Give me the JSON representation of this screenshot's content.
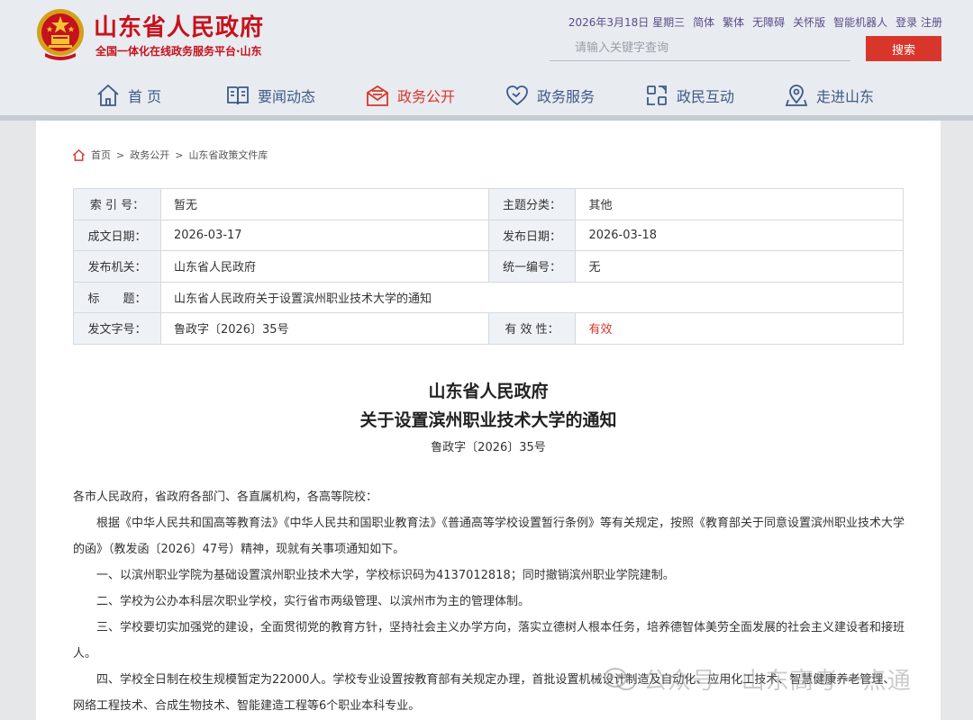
{
  "header": {
    "site_title": "山东省人民政府",
    "site_subtitle": "全国一体化在线政务服务平台·山东",
    "top_links": {
      "date": "2026年3月18日 星期三",
      "simplified": "简体",
      "traditional": "繁体",
      "accessibility": "无障碍",
      "elder_mode": "关怀版",
      "robot": "智能机器人",
      "login_register": "登录 注册"
    },
    "search": {
      "placeholder": "请输入关键字查询",
      "button": "搜索"
    },
    "nav": [
      {
        "label": "首 页",
        "icon": "home-icon"
      },
      {
        "label": "要闻动态",
        "icon": "book-icon"
      },
      {
        "label": "政务公开",
        "icon": "mail-icon"
      },
      {
        "label": "政务服务",
        "icon": "heart-icon"
      },
      {
        "label": "政民互动",
        "icon": "interaction-icon"
      },
      {
        "label": "走进山东",
        "icon": "location-icon"
      }
    ],
    "colors": {
      "brand_red": "#c6121c",
      "nav_blue": "#3d5a88",
      "accent": "#d9362b"
    }
  },
  "breadcrumb": {
    "items": [
      "首页",
      "政务公开",
      "山东省政策文件库"
    ],
    "separator": ">"
  },
  "meta": {
    "index_label": "索 引 号：",
    "index_value": "暂无",
    "topic_label": "主题分类：",
    "topic_value": "其他",
    "written_label": "成文日期：",
    "written_value": "2026-03-17",
    "published_label": "发布日期：",
    "published_value": "2026-03-18",
    "issuer_label": "发布机关：",
    "issuer_value": "山东省人民政府",
    "serial_label": "统一编号：",
    "serial_value": "无",
    "title_label": "标　　题：",
    "title_value": "山东省人民政府关于设置滨州职业技术大学的通知",
    "docno_label": "发文字号：",
    "docno_value": "鲁政字〔2026〕35号",
    "validity_label": "有 效 性：",
    "validity_value": "有效"
  },
  "document": {
    "title_line1": "山东省人民政府",
    "title_line2": "关于设置滨州职业技术大学的通知",
    "number": "鲁政字〔2026〕35号",
    "salutation": "各市人民政府，省政府各部门、各直属机构，各高等院校：",
    "paragraphs": [
      "根据《中华人民共和国高等教育法》《中华人民共和国职业教育法》《普通高等学校设置暂行条例》等有关规定，按照《教育部关于同意设置滨州职业技术大学的函》（教发函〔2026〕47号）精神，现就有关事项通知如下。",
      "一、以滨州职业学院为基础设置滨州职业技术大学，学校标识码为4137012818；同时撤销滨州职业学院建制。",
      "二、学校为公办本科层次职业学校，实行省市两级管理、以滨州市为主的管理体制。",
      "三、学校要切实加强党的建设，全面贯彻党的教育方针，坚持社会主义办学方向，落实立德树人根本任务，培养德智体美劳全面发展的社会主义建设者和接班人。",
      "四、学校全日制在校生规模暂定为22000人。学校专业设置按教育部有关规定办理，首批设置机械设计制造及自动化、应用化工技术、智慧健康养老管理、网络工程技术、合成生物技术、智能建造工程等6个职业本科专业。"
    ]
  },
  "watermark": "公众号 · 山东高考一点通"
}
